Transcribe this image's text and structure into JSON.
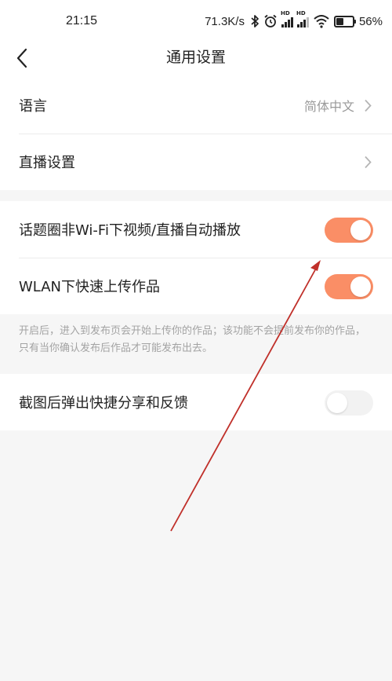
{
  "status_bar": {
    "time": "21:15",
    "net_speed": "71.3K/s",
    "signal_badge": "HD",
    "battery_percent": "56%",
    "battery_level": 0.56,
    "icons": [
      "bluetooth-icon",
      "alarm-icon",
      "signal-icon",
      "wifi-icon",
      "battery-icon"
    ]
  },
  "navbar": {
    "title": "通用设置",
    "back_icon": "chevron-left-icon"
  },
  "section1": {
    "language": {
      "label": "语言",
      "value": "简体中文"
    },
    "live_settings": {
      "label": "直播设置"
    }
  },
  "section2": {
    "autoplay": {
      "label": "话题圈非Wi-Fi下视频/直播自动播放",
      "on": true
    },
    "wlan_upload": {
      "label": "WLAN下快速上传作品",
      "on": true
    }
  },
  "hint": {
    "text": "开启后，进入到发布页会开始上传你的作品；该功能不会提前发布你的作品，只有当你确认发布后作品才可能发布出去。"
  },
  "section3": {
    "screenshot_share": {
      "label": "截图后弹出快捷分享和反馈",
      "on": false
    }
  },
  "colors": {
    "accent": "#fa8e66",
    "annotation_arrow": "#c0302a",
    "background": "#f6f6f6"
  }
}
